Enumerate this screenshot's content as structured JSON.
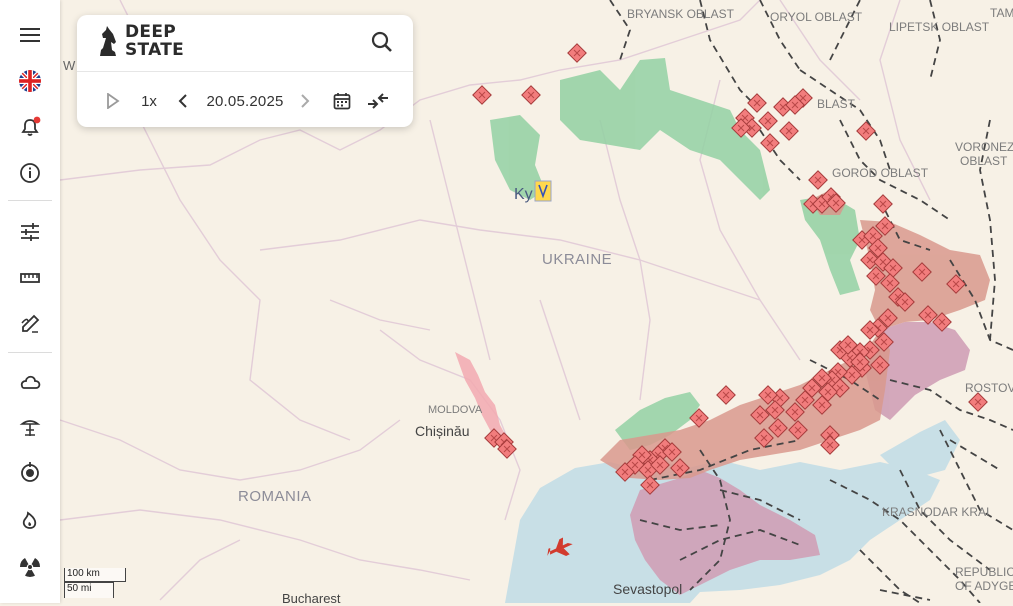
{
  "app": {
    "logo_line1": "DEEP",
    "logo_line2": "STATE"
  },
  "timeline": {
    "speed": "1x",
    "date": "20.05.2025"
  },
  "sidebar": {
    "items": [
      "menu-icon",
      "uk-flag-icon",
      "notifications-icon",
      "info-icon",
      "filters-icon",
      "ruler-icon",
      "draw-icon",
      "weather-icon",
      "nuclear-plant-icon",
      "target-icon",
      "fire-icon",
      "radiation-icon"
    ],
    "notification_dot_color": "#e53935"
  },
  "map": {
    "labels": {
      "bryansk": "BRYANSK OBLAST",
      "oryol": "ORYOL OBLAST",
      "lipetsk": "LIPETSK OBLAST",
      "tam": "TAM",
      "kursk": "BLAST",
      "belgorod": "GOROD OBLAST",
      "voronezh1": "VORONEZH",
      "voronezh2": "OBLAST",
      "ukraine": "UKRAINE",
      "kyiv": "Ky",
      "moldova": "MOLDOVA",
      "chisinau": "Chișinău",
      "romania": "ROMANIA",
      "bucharest": "Bucharest",
      "sevastopol": "Sevastopol",
      "rostov": "ROSTOV",
      "krasnodar": "KRASNODAR KRAI",
      "adygea1": "REPUBLIC",
      "adygea2": "OF ADYGEA",
      "w": "W"
    },
    "scale": {
      "km": "100 km",
      "mi": "50 mi"
    },
    "colors": {
      "land": "#f7f1e6",
      "sea": "#c8dfe6",
      "occupied": "#d9998d",
      "occupied_pre2022": "#cfa0b6",
      "liberated": "#93d1a3",
      "transnistria": "#f2a9b0",
      "marker": "#f27d7d"
    }
  }
}
